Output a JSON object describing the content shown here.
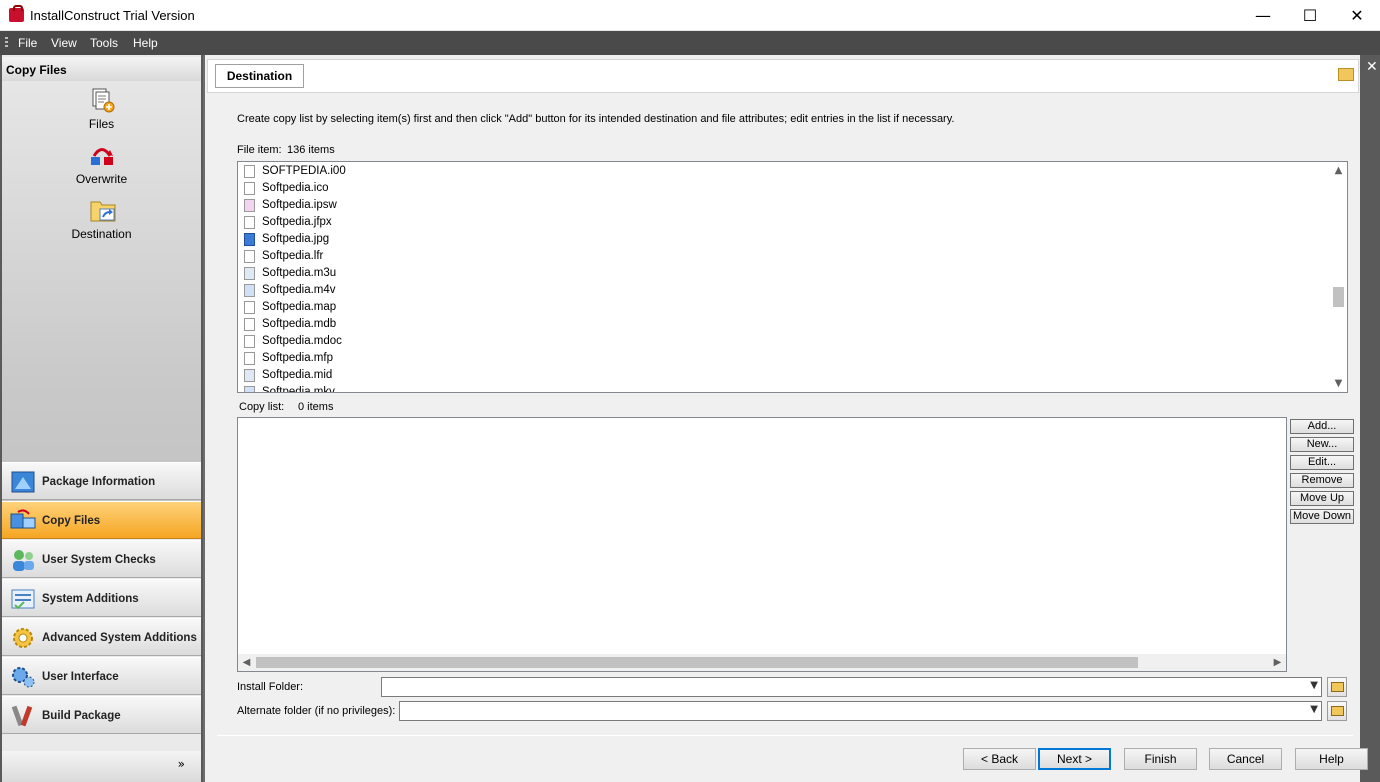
{
  "window": {
    "title": "InstallConstruct Trial Version",
    "minimize": "—",
    "maximize": "☐",
    "close": "✕"
  },
  "menu": [
    "File",
    "View",
    "Tools",
    "Help"
  ],
  "left_panel": {
    "header": "Copy Files",
    "tools": [
      {
        "label": "Files",
        "icon": "files-icon"
      },
      {
        "label": "Overwrite",
        "icon": "overwrite-icon"
      },
      {
        "label": "Destination",
        "icon": "destination-icon"
      }
    ],
    "nav": [
      {
        "label": "Package Information",
        "active": false
      },
      {
        "label": "Copy Files",
        "active": true
      },
      {
        "label": "User System Checks",
        "active": false
      },
      {
        "label": "System Additions",
        "active": false
      },
      {
        "label": "Advanced System Additions",
        "active": false
      },
      {
        "label": "User Interface",
        "active": false
      },
      {
        "label": "Build Package",
        "active": false
      }
    ],
    "expand_glyph": "»"
  },
  "tab": {
    "label": "Destination",
    "close": "✕"
  },
  "content": {
    "instructions": "Create copy list by selecting item(s) first and then click \"Add\" button for its intended destination and file attributes; edit entries in the list if necessary.",
    "file_item_label": "File item:",
    "file_item_count": "136 items",
    "files": [
      {
        "name": "SOFTPEDIA.i00",
        "kind": "blank"
      },
      {
        "name": "Softpedia.ico",
        "kind": "blank"
      },
      {
        "name": "Softpedia.ipsw",
        "kind": "ipsw"
      },
      {
        "name": "Softpedia.jfpx",
        "kind": "blank"
      },
      {
        "name": "Softpedia.jpg",
        "kind": "img"
      },
      {
        "name": "Softpedia.lfr",
        "kind": "blank"
      },
      {
        "name": "Softpedia.m3u",
        "kind": "mus"
      },
      {
        "name": "Softpedia.m4v",
        "kind": "vid"
      },
      {
        "name": "Softpedia.map",
        "kind": "blank"
      },
      {
        "name": "Softpedia.mdb",
        "kind": "blank"
      },
      {
        "name": "Softpedia.mdoc",
        "kind": "blank"
      },
      {
        "name": "Softpedia.mfp",
        "kind": "blank"
      },
      {
        "name": "Softpedia.mid",
        "kind": "mus"
      },
      {
        "name": "Softpedia.mkv",
        "kind": "vid"
      }
    ],
    "copy_list_label": "Copy list:",
    "copy_list_count": "0 items",
    "side_buttons": [
      "Add...",
      "New...",
      "Edit...",
      "Remove",
      "Move Up",
      "Move Down"
    ],
    "install_folder_label": "Install Folder:",
    "install_folder_value": "",
    "alternate_folder_label": "Alternate folder (if no privileges):",
    "alternate_folder_value": ""
  },
  "wizard_buttons": {
    "back": "< Back",
    "next": "Next >",
    "finish": "Finish",
    "cancel": "Cancel",
    "help": "Help"
  }
}
